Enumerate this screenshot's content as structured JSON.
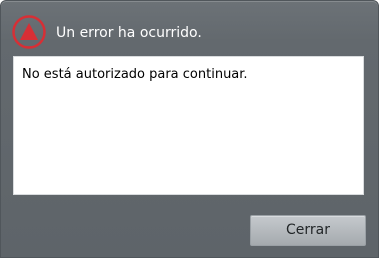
{
  "dialog": {
    "title": "Un error ha ocurrido.",
    "icon": "error-warning-icon",
    "message": "No está autorizado para continuar.",
    "close_label": "Cerrar"
  },
  "colors": {
    "background": "#5e6469",
    "title_text": "#ffffff",
    "icon_red": "#d72f35",
    "message_background": "#ffffff",
    "button_background": "#b5babe"
  }
}
